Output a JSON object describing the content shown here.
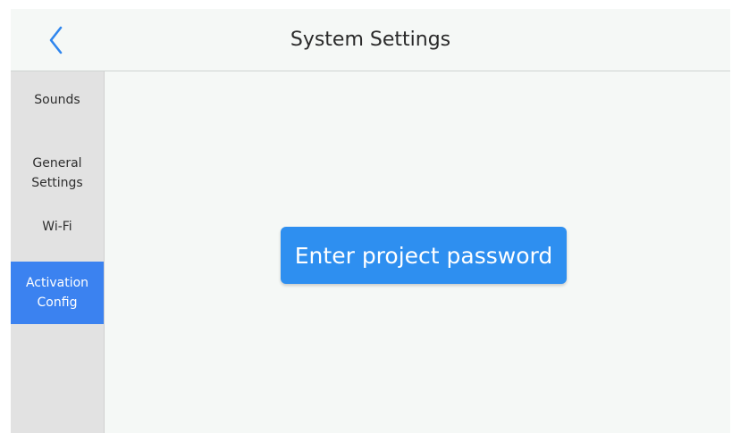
{
  "header": {
    "title": "System Settings",
    "back_icon": "chevron-left-icon"
  },
  "sidebar": {
    "items": [
      {
        "label": "Sounds",
        "active": false
      },
      {
        "label": "General\nSettings",
        "active": false
      },
      {
        "label": "Wi-Fi",
        "active": false
      },
      {
        "label": "Activation\nConfig",
        "active": true
      }
    ]
  },
  "main": {
    "password_button_label": "Enter project password"
  },
  "colors": {
    "accent": "#3b82f0",
    "button": "#2e8ff0",
    "background": "#f5f8f6",
    "sidebar": "#e2e2e2"
  }
}
